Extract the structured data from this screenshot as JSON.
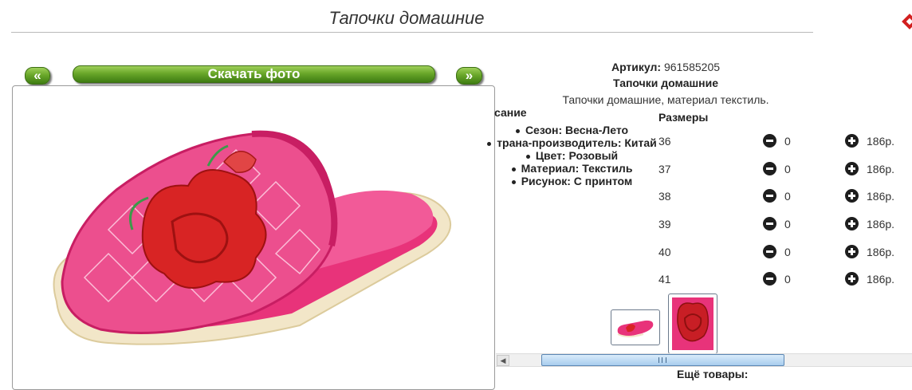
{
  "header": {
    "title": "Тапочки домашние"
  },
  "gallery": {
    "prev_label": "«",
    "download_label": "Скачать фото",
    "next_label": "»"
  },
  "product": {
    "article_label": "Артикул:",
    "article_value": "961585205",
    "name": "Тапочки домашние",
    "description": "Тапочки домашние, материал текстиль.",
    "desc_heading": "сание",
    "attributes": [
      "Сезон: Весна-Лето",
      "трана-производитель: Китай",
      "Цвет: Розовый",
      "Материал: Текстиль",
      "Рисунок: С принтом"
    ]
  },
  "sizes": {
    "heading": "Размеры",
    "rows": [
      {
        "size": "36",
        "qty": "0",
        "price": "186р."
      },
      {
        "size": "37",
        "qty": "0",
        "price": "186р."
      },
      {
        "size": "38",
        "qty": "0",
        "price": "186р."
      },
      {
        "size": "39",
        "qty": "0",
        "price": "186р."
      },
      {
        "size": "40",
        "qty": "0",
        "price": "186р."
      },
      {
        "size": "41",
        "qty": "0",
        "price": "186р."
      }
    ]
  },
  "more": {
    "label": "Ещё товары:"
  },
  "colors": {
    "button_green": "#6aa82a",
    "slipper_pink": "#e8337a",
    "flower_red": "#d82424"
  }
}
